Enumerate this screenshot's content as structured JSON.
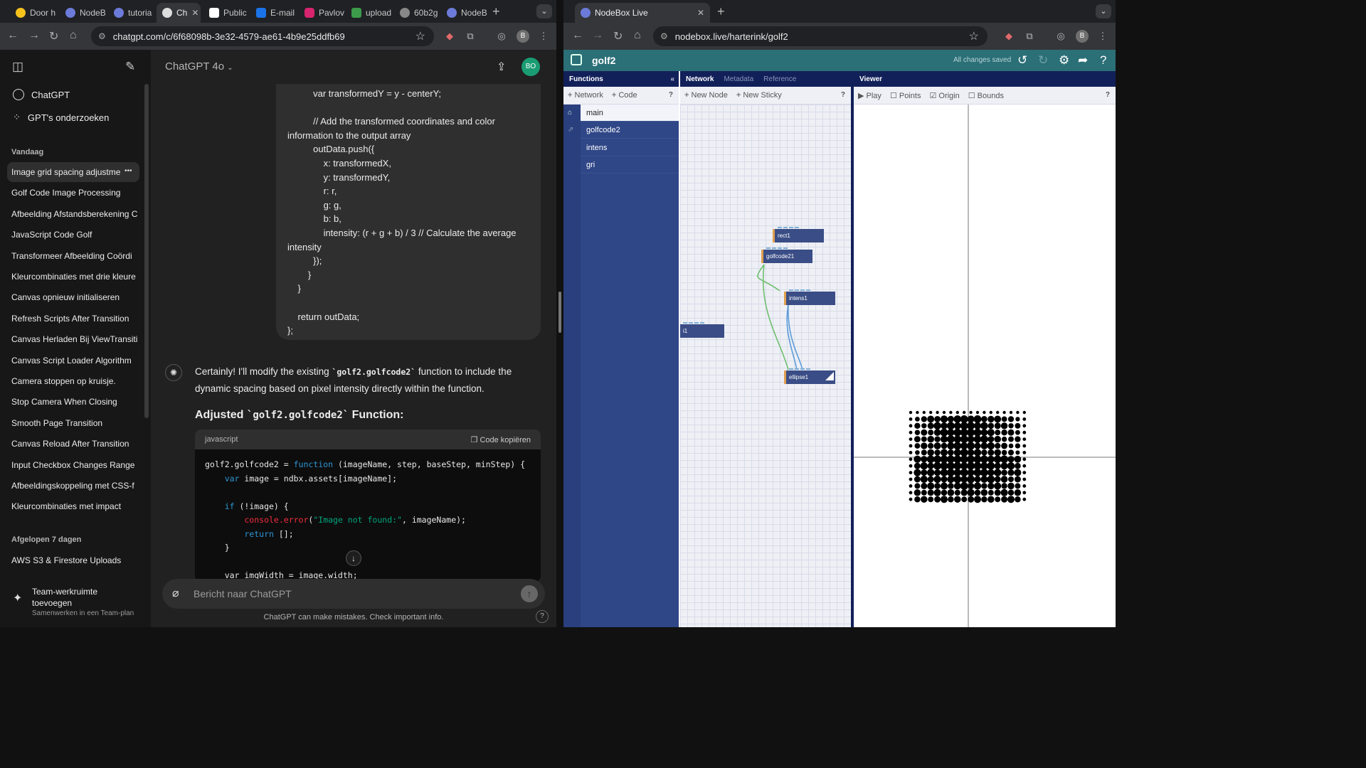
{
  "left_window": {
    "tabs": [
      {
        "label": "Door h"
      },
      {
        "label": "NodeB"
      },
      {
        "label": "tutoria"
      },
      {
        "label": "Ch"
      },
      {
        "label": "Public"
      },
      {
        "label": "E-mail"
      },
      {
        "label": "Pavlov"
      },
      {
        "label": "upload"
      },
      {
        "label": "60b2g"
      },
      {
        "label": "NodeB"
      }
    ],
    "url": "chatgpt.com/c/6f68098b-3e32-4579-ae61-4b9e25ddfb69",
    "profile_initial": "B"
  },
  "chatgpt": {
    "model": "ChatGPT 4o",
    "avatar": "BO",
    "nav": [
      {
        "label": "ChatGPT"
      },
      {
        "label": "GPT's onderzoeken"
      }
    ],
    "section_today": "Vandaag",
    "today_items": [
      {
        "label": "Image grid spacing adjustme"
      },
      {
        "label": "Golf Code Image Processing"
      },
      {
        "label": "Afbeelding Afstandsberekening C"
      },
      {
        "label": "JavaScript Code Golf"
      },
      {
        "label": "Transformeer Afbeelding Coördi"
      },
      {
        "label": "Kleurcombinaties met drie kleure"
      },
      {
        "label": "Canvas opnieuw initialiseren"
      },
      {
        "label": "Refresh Scripts After Transition"
      },
      {
        "label": "Canvas Herladen Bij ViewTransiti"
      },
      {
        "label": "Canvas Script Loader Algorithm"
      },
      {
        "label": "Camera stoppen op kruisje."
      },
      {
        "label": "Stop Camera When Closing"
      },
      {
        "label": "Smooth Page Transition"
      },
      {
        "label": "Canvas Reload After Transition"
      },
      {
        "label": "Input Checkbox Changes Range"
      },
      {
        "label": "Afbeeldingskoppeling met CSS-f"
      },
      {
        "label": "Kleurcombinaties met impact"
      }
    ],
    "section_week": "Afgelopen 7 dagen",
    "week_items": [
      {
        "label": "AWS S3 & Firestore Uploads"
      }
    ],
    "team_title": "Team-werkruimte toevoegen",
    "team_sub": "Samenwerken in een Team-plan",
    "user_code_lines": [
      "          var transformedY = y - centerY;",
      "",
      "          // Add the transformed coordinates and color",
      "information to the output array",
      "          outData.push({",
      "              x: transformedX,",
      "              y: transformedY,",
      "              r: r,",
      "              g: g,",
      "              b: b,",
      "              intensity: (r + g + b) / 3 // Calculate the average",
      "intensity",
      "          });",
      "        }",
      "    }",
      "",
      "    return outData;",
      "};"
    ],
    "reply_before": "Certainly! I'll modify the existing ",
    "reply_code": "`golf2.golfcode2`",
    "reply_after": " function to include the dynamic spacing based on pixel intensity directly within the function.",
    "heading_before": "Adjusted ",
    "heading_code": "`golf2.golfcode2`",
    "heading_after": " Function:",
    "code_lang": "javascript",
    "copy_label": "Code kopiëren",
    "code": {
      "l1_a": "golf2.golfcode2 = ",
      "l1_kw": "function",
      "l1_b": " (imageName, step, baseStep, minStep) {",
      "l2_kw": "    var",
      "l2_b": " image = ndbx.assets[imageName];",
      "l4_kw": "    if",
      "l4_b": " (!image) {",
      "l5_fn": "        console.error",
      "l5_p": "(",
      "l5_st": "\"Image not found:\"",
      "l5_b": ", imageName);",
      "l6_kw": "        return",
      "l6_b": " [];",
      "l7": "    }",
      "l9": "    var imgWidth = image.width;"
    },
    "composer_placeholder": "Bericht naar ChatGPT",
    "disclaimer": "ChatGPT can make mistakes. Check important info.",
    "help": "?"
  },
  "right_window": {
    "tab_title": "NodeBox Live",
    "url": "nodebox.live/harterink/golf2",
    "profile_initial": "B"
  },
  "nodebox": {
    "title": "golf2",
    "saved": "All changes saved",
    "functions_header": "Functions",
    "fn_toolbar": [
      "Network",
      "Code"
    ],
    "functions": [
      {
        "label": "main"
      },
      {
        "label": "golfcode2"
      },
      {
        "label": "intens"
      },
      {
        "label": "gri"
      }
    ],
    "network_tabs": [
      "Network",
      "Metadata",
      "Reference"
    ],
    "net_toolbar": [
      "New Node",
      "New Sticky"
    ],
    "nodes": {
      "rect": "rect1",
      "golf": "golfcode21",
      "intens": "intens1",
      "edge": "i1",
      "ellipse": "ellipse1"
    },
    "viewer_header": "Viewer",
    "viewer_toolbar": {
      "play": "Play",
      "points": "Points",
      "origin": "Origin",
      "bounds": "Bounds"
    },
    "q": "?"
  }
}
